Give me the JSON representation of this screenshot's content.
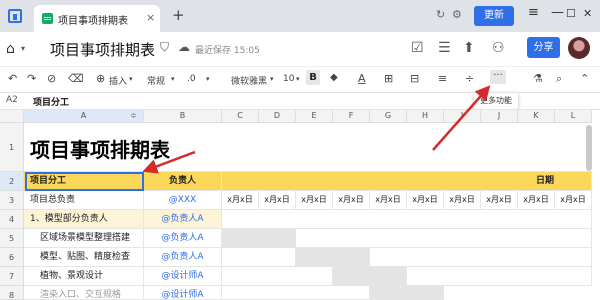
{
  "window": {
    "tab_title": "项目事项排期表",
    "tab_close": "×",
    "tab_add": "+",
    "upgrade_label": "更新",
    "icons": [
      "history-icon",
      "settings-icon",
      "menu-icon",
      "minimize-icon",
      "maximize-icon",
      "close-icon"
    ],
    "min": "—",
    "max": "☐",
    "close": "✕"
  },
  "header": {
    "home": "⌂",
    "home_caret": "▾",
    "doc_title": "项目事项排期表",
    "star": "☆",
    "tag": "⛉",
    "cloud": "☁",
    "saved_text": "最近保存 15:05",
    "share_label": "分享"
  },
  "toolbar": {
    "undo": "↶",
    "redo": "↷",
    "format_painter": "⊘",
    "eraser": "⌫",
    "insert_label": "插入",
    "number_format": "常规",
    "decimal": ".0",
    "font": "微软雅黑",
    "font_size": "10",
    "bold": "B",
    "fill_color": "◆",
    "font_color": "A",
    "borders": "⊞",
    "merge": "⊟",
    "align": "≡",
    "valign": "÷",
    "more": "···",
    "more_tooltip": "更多功能"
  },
  "formula_bar": {
    "cell_ref": "A2",
    "value": "项目分工"
  },
  "grid": {
    "columns": [
      "A",
      "B",
      "C",
      "D",
      "E",
      "F",
      "G",
      "H",
      "I",
      "J",
      "K",
      "L"
    ],
    "rows": [
      "1",
      "2",
      "3",
      "4",
      "5",
      "6",
      "7",
      "8"
    ],
    "title": "项目事项排期表",
    "r2": {
      "a": "项目分工",
      "b": "负责人",
      "date": "日期"
    },
    "r3": {
      "a": "项目总负责",
      "b": "@XXX",
      "date_cell": "x月x日"
    },
    "r4": {
      "a": "1、模型部分负责人",
      "b": "@负责人A"
    },
    "r5": {
      "a": "区域场景模型整理搭建",
      "b": "@负责人A"
    },
    "r6": {
      "a": "模型、贴图、精度检查",
      "b": "@负责人A"
    },
    "r7": {
      "a": "植物、景观设计",
      "b": "@设计师A"
    },
    "r8": {
      "a": "渲染入口、交互规格",
      "b": "@设计师A"
    }
  },
  "colors": {
    "header_yellow": "#fbd85a",
    "section_yellow": "#fdf3d7",
    "accent_blue": "#2f6fe8",
    "arrow_red": "#d42a2a"
  }
}
